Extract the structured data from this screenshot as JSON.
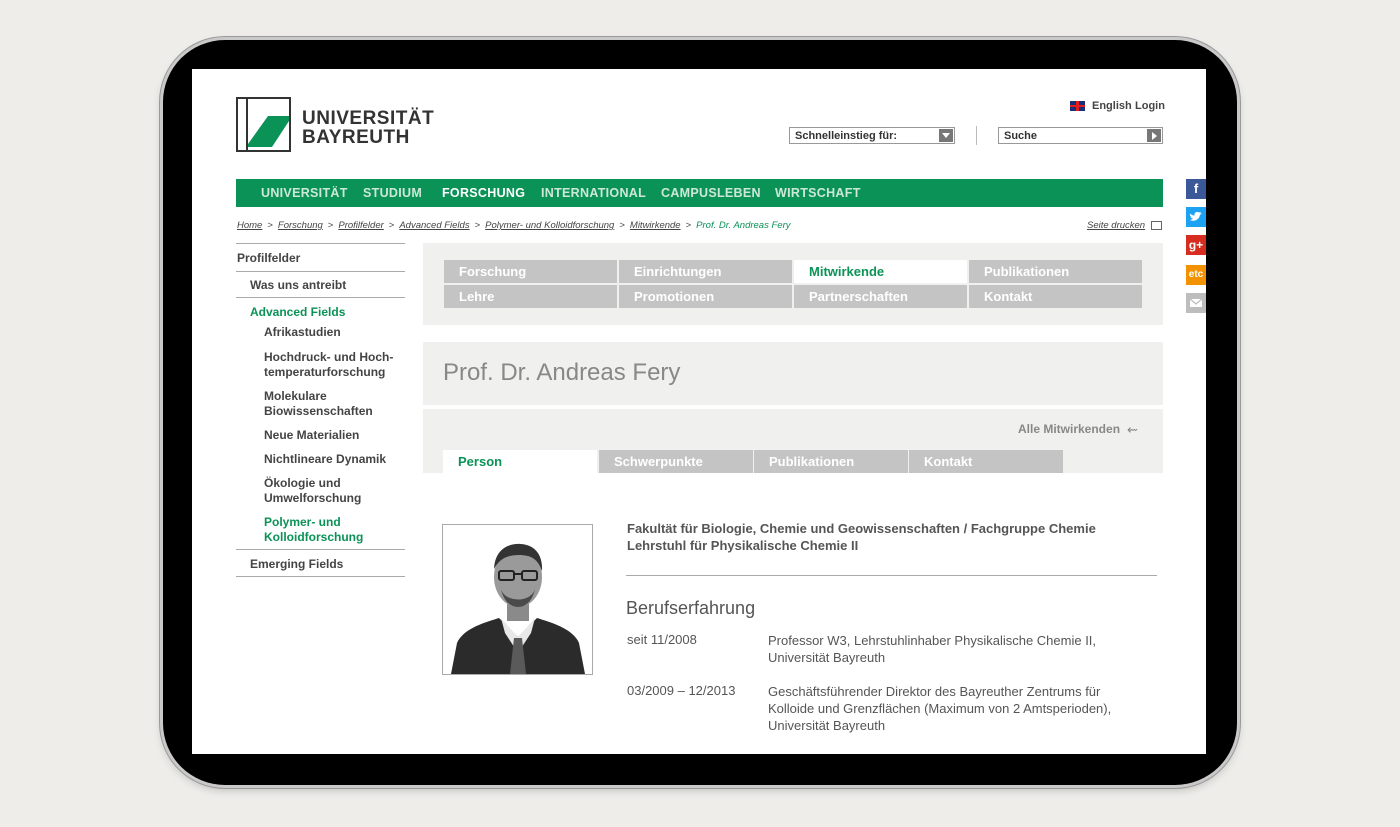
{
  "header": {
    "logo_line1": "UNIVERSITÄT",
    "logo_line2": "BAYREUTH",
    "lang_label": "English",
    "login_label": "Login",
    "quick_access_placeholder": "Schnelleinstieg für:",
    "search_placeholder": "Suche"
  },
  "nav": {
    "items": [
      "UNIVERSITÄT",
      "STUDIUM",
      "FORSCHUNG",
      "INTERNATIONAL",
      "CAMPUSLEBEN",
      "WIRTSCHAFT"
    ],
    "active": "FORSCHUNG"
  },
  "breadcrumb": {
    "items": [
      "Home",
      "Forschung",
      "Profilfelder",
      "Advanced Fields",
      "Polymer- und Kolloidforschung",
      "Mitwirkende"
    ],
    "current": "Prof. Dr. Andreas Fery",
    "print_label": "Seite drucken"
  },
  "sidebar": {
    "root": "Profilfelder",
    "l1_a": "Was uns antreibt",
    "l1_b": "Advanced Fields",
    "children": [
      [
        "Afrikastudien"
      ],
      [
        "Hochdruck- und Hoch-",
        "temperaturforschung"
      ],
      [
        "Molekulare",
        "Biowissenschaften"
      ],
      [
        "Neue Materialien"
      ],
      [
        "Nichtlineare Dynamik"
      ],
      [
        "Ökologie und",
        "Umwelforschung"
      ],
      [
        "Polymer- und",
        "Kolloidforschung"
      ]
    ],
    "l1_c": "Emerging Fields"
  },
  "section_tabs": {
    "row1": [
      "Forschung",
      "Einrichtungen",
      "Mitwirkende",
      "Publikationen"
    ],
    "row2": [
      "Lehre",
      "Promotionen",
      "Partnerschaften",
      "Kontakt"
    ],
    "selected": "Mitwirkende"
  },
  "person": {
    "name": "Prof. Dr. Andreas Fery",
    "all_members_label": "Alle Mitwirkenden",
    "tabs": [
      "Person",
      "Schwerpunkte",
      "Publikationen",
      "Kontakt"
    ],
    "selected_tab": "Person",
    "faculty_line1": "Fakultät für Biologie, Chemie und Geowissenschaften / Fachgruppe Chemie",
    "faculty_line2": "Lehrstuhl für Physikalische Chemie II",
    "section_heading": "Berufserfahrung",
    "cv": [
      {
        "date": "seit 11/2008",
        "text": "Professor W3, Lehrstuhlinhaber Physikalische Chemie II, Universität Bayreuth"
      },
      {
        "date": "03/2009 – 12/2013",
        "text": "Geschäftsführender Direktor des Bayreuther Zentrums für Kolloide und Grenzflächen (Maximum von 2 Amtsperioden), Universität Bayreuth"
      }
    ]
  },
  "social": {
    "facebook": "f",
    "googleplus": "g+",
    "etc": "etc",
    "colors": {
      "facebook": "#3b5998",
      "twitter": "#1da1f2",
      "googleplus": "#d62d20",
      "etc": "#f39200",
      "mail": "#bdbdbd"
    }
  },
  "colors": {
    "brand_green": "#0b9257",
    "tab_gray": "#c4c4c4",
    "panel_bg": "#f0f0ee"
  }
}
